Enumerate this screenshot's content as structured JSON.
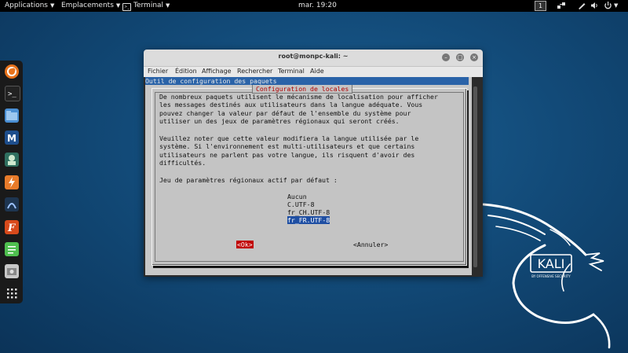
{
  "topbar": {
    "applications": "Applications",
    "places": "Emplacements",
    "terminal": "Terminal",
    "clock": "mar. 19:20",
    "workspace": "1"
  },
  "dock": {
    "items": [
      {
        "icon": "firefox-icon",
        "color": "#e8731c"
      },
      {
        "icon": "terminal-icon",
        "color": "#222222"
      },
      {
        "icon": "files-icon",
        "color": "#4a8fd4"
      },
      {
        "icon": "metasploit-icon",
        "color": "#1e4e8c"
      },
      {
        "icon": "armitage-icon",
        "color": "#2f6f5f"
      },
      {
        "icon": "burpsuite-icon",
        "color": "#e87b2a"
      },
      {
        "icon": "beef-icon",
        "color": "#1e3550"
      },
      {
        "icon": "faraday-icon",
        "color": "#d84a1b"
      },
      {
        "icon": "leafpad-icon",
        "color": "#4fbf4f"
      },
      {
        "icon": "screenshot-icon",
        "color": "#c8c8c8"
      },
      {
        "icon": "app-grid-icon",
        "color": "#1a1a1a"
      }
    ]
  },
  "window": {
    "title": "root@monpc-kali: ~",
    "menu": [
      "Fichier",
      "Édition",
      "Affichage",
      "Rechercher",
      "Terminal",
      "Aide"
    ]
  },
  "tui": {
    "backtitle": "Outil de configuration des paquets",
    "dialog_title": "Configuration de locales",
    "paragraph1": "De nombreux paquets utilisent le mécanisme de localisation pour afficher\nles messages destinés aux utilisateurs dans la langue adéquate. Vous\npouvez changer la valeur par défaut de l'ensemble du système pour\nutiliser un des jeux de paramètres régionaux qui seront créés.",
    "paragraph2": "Veuillez noter que cette valeur modifiera la langue utilisée par le\nsystème. Si l'environnement est multi-utilisateurs et que certains\nutilisateurs ne parlent pas votre langue, ils risquent d'avoir des\ndifficultés.",
    "prompt": "Jeu de paramètres régionaux actif par défaut :",
    "options": [
      "Aucun",
      "C.UTF-8",
      "fr_CH.UTF-8",
      "fr_FR.UTF-8"
    ],
    "selected_option": "fr_FR.UTF-8",
    "ok_button": "<Ok>",
    "cancel_button": "<Annuler>"
  },
  "desktop": {
    "logo_text": "KALI",
    "logo_subtext": "BY OFFENSIVE SECURITY"
  },
  "colors": {
    "desktop_bg": "#124a78",
    "dialog_bg": "#c4c4c4",
    "accent_red": "#c00000",
    "selection_blue": "#1f4fa3",
    "backtitle_blue": "#2a63a8"
  }
}
